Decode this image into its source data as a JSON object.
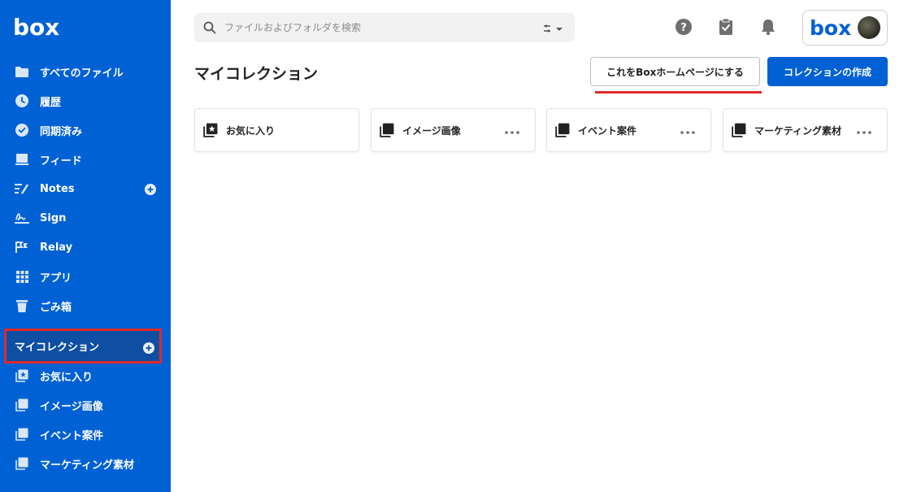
{
  "brand": {
    "logo_text": "box",
    "sidebar_color": "#0061d5",
    "accent_red": "#e0292b"
  },
  "sidebar": {
    "items": [
      {
        "label": "すべてのファイル",
        "icon": "folder-icon"
      },
      {
        "label": "履歴",
        "icon": "clock-icon"
      },
      {
        "label": "同期済み",
        "icon": "check-circle-icon"
      },
      {
        "label": "フィード",
        "icon": "feed-icon"
      },
      {
        "label": "Notes",
        "icon": "notes-icon",
        "has_add": true
      },
      {
        "label": "Sign",
        "icon": "sign-icon"
      },
      {
        "label": "Relay",
        "icon": "relay-icon"
      },
      {
        "label": "アプリ",
        "icon": "apps-grid-icon"
      },
      {
        "label": "ごみ箱",
        "icon": "trash-icon"
      }
    ],
    "collections_section": {
      "label": "マイコレクション"
    },
    "collections": [
      {
        "label": "お気に入り",
        "icon": "favorites-icon"
      },
      {
        "label": "イメージ画像",
        "icon": "collection-icon"
      },
      {
        "label": "イベント案件",
        "icon": "collection-icon"
      },
      {
        "label": "マーケティング素材",
        "icon": "collection-icon"
      }
    ]
  },
  "search": {
    "placeholder": "ファイルおよびフォルダを検索"
  },
  "header": {
    "title": "マイコレクション",
    "set_home_label": "これをBoxホームページにする",
    "create_label": "コレクションの作成"
  },
  "cards": [
    {
      "label": "お気に入り",
      "icon": "favorites-icon",
      "has_menu": false
    },
    {
      "label": "イメージ画像",
      "icon": "collection-icon",
      "has_menu": true
    },
    {
      "label": "イベント案件",
      "icon": "collection-icon",
      "has_menu": true
    },
    {
      "label": "マーケティング素材",
      "icon": "collection-icon",
      "has_menu": true
    }
  ],
  "account": {
    "logo_text": "box"
  }
}
